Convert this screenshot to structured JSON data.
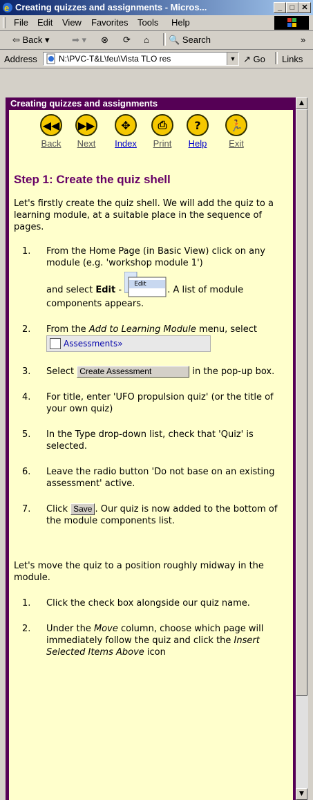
{
  "window": {
    "title": "Creating quizzes and assignments - Micros..."
  },
  "menubar": [
    "File",
    "Edit",
    "View",
    "Favorites",
    "Tools",
    "Help"
  ],
  "toolbar": {
    "back": "Back",
    "search": "Search",
    "more": "»"
  },
  "addressbar": {
    "label": "Address",
    "url": "N:\\PVC-T&L\\feu\\Vista TLO res",
    "go": "Go",
    "links": "Links"
  },
  "frame": {
    "title": "Creating quizzes and assignments"
  },
  "nav": [
    {
      "label": "Back",
      "icon": "rewind-icon"
    },
    {
      "label": "Next",
      "icon": "forward-icon"
    },
    {
      "label": "Index",
      "icon": "index-icon"
    },
    {
      "label": "Print",
      "icon": "print-icon"
    },
    {
      "label": "Help",
      "icon": "help-icon"
    },
    {
      "label": "Exit",
      "icon": "exit-icon"
    }
  ],
  "content": {
    "heading": "Step 1: Create the quiz shell",
    "intro": "Let's firstly create the quiz shell. We will add the quiz to a learning module, at a suitable place in the sequence of pages.",
    "steps": [
      {
        "num": "1.",
        "text": "From the Home Page (in Basic View) click on any module (e.g. 'workshop module 1')"
      },
      {
        "num": "",
        "text_a": "and select ",
        "bold": "Edit",
        "text_b": " - ",
        "text_c": ". A list of module components appears.",
        "edit_menu": "Edit"
      },
      {
        "num": "2.",
        "text_a": "From the ",
        "italic": "Add to Learning Module",
        "text_b": " menu, select",
        "assess": "Assessments»"
      },
      {
        "num": "3.",
        "text_a": "Select ",
        "btn": "Create Assessment",
        "text_b": " in the pop-up box."
      },
      {
        "num": "4.",
        "text": "For title, enter 'UFO propulsion quiz' (or the title of your own quiz)"
      },
      {
        "num": "5.",
        "text": "In the Type drop-down list, check that 'Quiz' is selected."
      },
      {
        "num": "6.",
        "text": "Leave the radio button 'Do not base on an existing assessment' active."
      },
      {
        "num": "7.",
        "text_a": "Click ",
        "btn": "Save",
        "text_b": ". Our quiz is now added to the bottom of the module components list."
      }
    ],
    "move_intro": "Let's move the quiz to a position roughly midway in the module.",
    "move_steps": [
      {
        "num": "1.",
        "text": "Click the check box alongside our quiz name."
      },
      {
        "num": "2.",
        "text_a": "Under the ",
        "italic": "Move",
        "text_b": " column, choose which page will immediately follow the quiz and click the ",
        "italic2": "Insert Selected Items Above",
        "text_c": " icon"
      }
    ]
  }
}
